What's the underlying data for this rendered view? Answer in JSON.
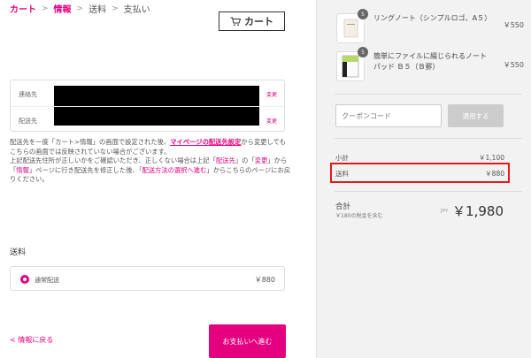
{
  "breadcrumb": {
    "cart": "カート",
    "info": "情報",
    "shipping": "送料",
    "payment": "支払い",
    "separator": ">"
  },
  "cart_button": {
    "label": "カート",
    "icon": "cart-icon"
  },
  "address": {
    "contact_label": "連絡先",
    "ship_to_label": "配送先",
    "change_label": "変更"
  },
  "notice": {
    "p1_a": "配送先を一度「カート>情報」の画面で設定された後、",
    "p1_link": "マイページの配送先設定",
    "p1_b": "から変更してもこちらの画面では反映されていない場合がございます。",
    "p2_a": "上記配送先住所が正しいかをご確認いただき、正しくない場合は上記「",
    "p2_hl1": "配送先",
    "p2_b": "」の「",
    "p2_hl2": "変更",
    "p2_c": "」から「",
    "p2_hl3": "情報",
    "p2_d": "」ページに行き配送先を修正した後、「",
    "p2_hl4": "配送方法の選択へ進む",
    "p2_e": "」からこちらのページにお戻りください。"
  },
  "shipping": {
    "title": "送料",
    "method": "通常配送",
    "price": "￥880"
  },
  "back_link": "< 情報に戻る",
  "pay_button": "お支払いへ進む",
  "order": {
    "items": [
      {
        "name": "リングノート（シンプルロゴ、A５）",
        "qty": "5",
        "price": "￥550"
      },
      {
        "name": "簡単にファイルに綴じられるノートパッド Ｂ５（Ｂ罫）",
        "qty": "5",
        "price": "￥550"
      }
    ],
    "coupon_placeholder": "クーポンコード",
    "coupon_button": "適用する",
    "subtotal_label": "小計",
    "subtotal": "￥1,100",
    "shipping_label": "送料",
    "shipping": "￥880",
    "total_label": "合計",
    "tax_note": "￥180の税金を含む",
    "currency": "JPY",
    "total": "￥1,980"
  },
  "colors": {
    "accent": "#e5007f",
    "highlight": "#e31a1a"
  }
}
